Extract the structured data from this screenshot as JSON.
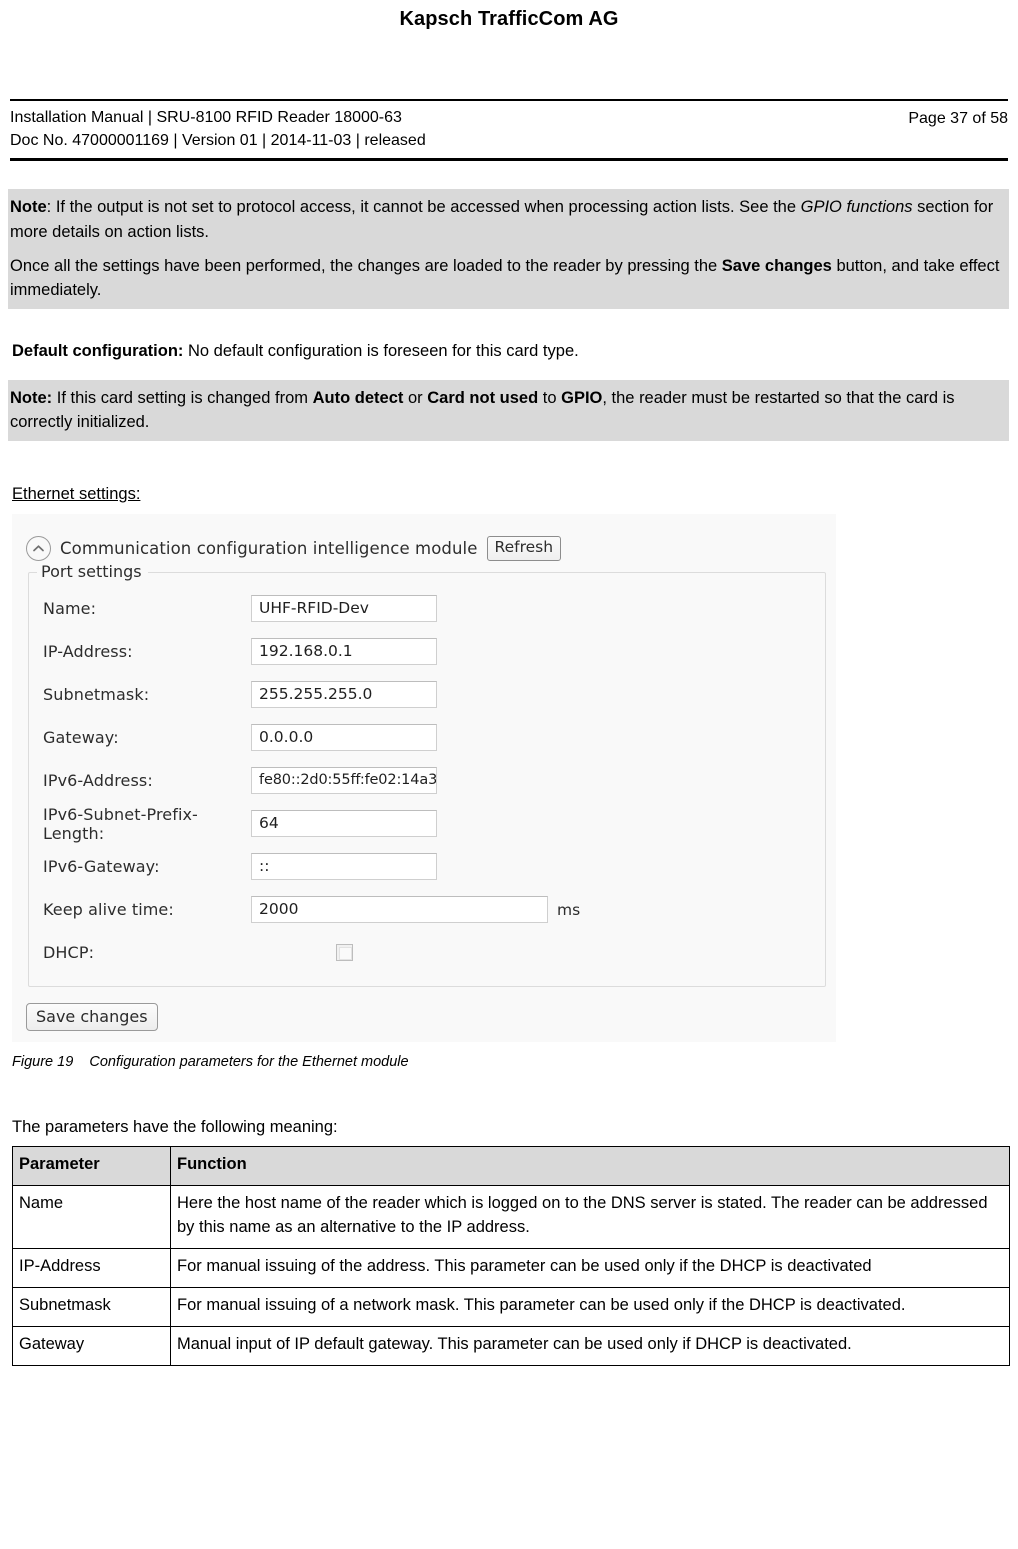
{
  "header": {
    "company": "Kapsch TrafficCom AG",
    "doc_line1": "Installation Manual | SRU-8100 RFID Reader 18000-63",
    "doc_line2": "Doc No. 47000001169 | Version 01 | 2014-11-03 | released",
    "page_label": "Page 37 of 58"
  },
  "notes": {
    "note1": {
      "p1_bold": "Note",
      "p1_a": ": If the output is not set to protocol access, it cannot be accessed when processing action lists. See the ",
      "p1_italic": "GPIO functions",
      "p1_b": " section for more details on action lists.",
      "p2_a": "Once all the settings have been performed, the changes are loaded to the reader by pressing the ",
      "p2_bold": "Save changes",
      "p2_b": " button, and take effect immediately."
    },
    "default_config": {
      "bold": "Default configuration:",
      "text": " No default configuration is foreseen for this card type."
    },
    "note2": {
      "bold": "Note:",
      "a": " If this card setting is changed from ",
      "b1": "Auto detect",
      "b": " or ",
      "b2": "Card not used",
      "c": " to ",
      "b3": "GPIO",
      "d": ", the reader must be restarted so that the card is correctly initialized."
    },
    "ethernet_heading": "Ethernet settings:"
  },
  "figure": {
    "collapse_icon": "chevron-up-icon",
    "panel_title": "Communication configuration intelligence module",
    "refresh_label": "Refresh",
    "group_legend": "Port settings",
    "fields": [
      {
        "label": "Name:",
        "value": "UHF-RFID-Dev",
        "unit": ""
      },
      {
        "label": "IP-Address:",
        "value": "192.168.0.1",
        "unit": ""
      },
      {
        "label": "Subnetmask:",
        "value": "255.255.255.0",
        "unit": ""
      },
      {
        "label": "Gateway:",
        "value": "0.0.0.0",
        "unit": ""
      },
      {
        "label": "IPv6-Address:",
        "value": "fe80::2d0:55ff:fe02:14a3",
        "unit": ""
      },
      {
        "label": "IPv6-Subnet-Prefix-Length:",
        "value": "64",
        "unit": ""
      },
      {
        "label": "IPv6-Gateway:",
        "value": "::",
        "unit": ""
      },
      {
        "label": "Keep alive time:",
        "value": "2000",
        "unit": "ms"
      }
    ],
    "dhcp_label": "DHCP:",
    "dhcp_checked": false,
    "save_label": "Save changes",
    "caption_number": "Figure 19",
    "caption_text": "Configuration parameters for the Ethernet module"
  },
  "table_section": {
    "intro": "The parameters have the following meaning:",
    "columns": [
      "Parameter",
      "Function"
    ],
    "rows": [
      {
        "parameter": "Name",
        "function": "Here the host name of the reader which is logged on to the DNS server is stated. The reader can be addressed by this name as an alternative to the IP address."
      },
      {
        "parameter": "IP-Address",
        "function": "For manual issuing of the address. This parameter can be used only if the DHCP is deactivated"
      },
      {
        "parameter": "Subnetmask",
        "function": "For manual issuing of a network mask. This parameter can be used only if the DHCP is deactivated."
      },
      {
        "parameter": "Gateway",
        "function": "Manual input of IP default gateway. This parameter can be used only if DHCP is deactivated."
      }
    ]
  },
  "colors": {
    "note_background": "#d9d9d9",
    "table_header_background": "#d9d9d9",
    "figure_background": "#f9f9f9"
  }
}
